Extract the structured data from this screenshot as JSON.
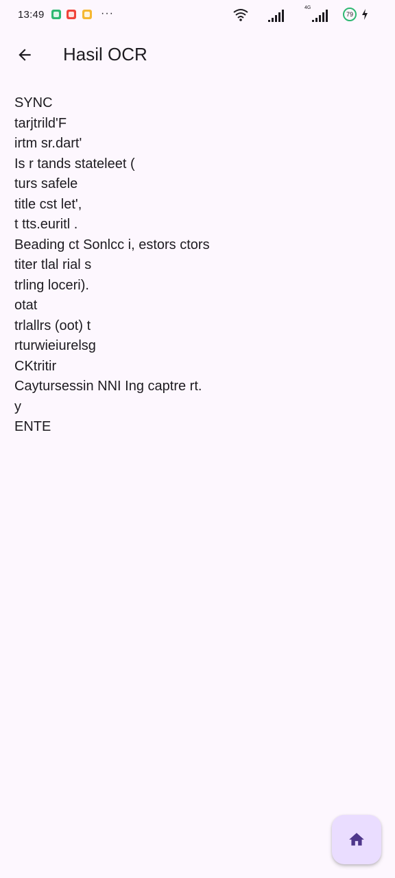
{
  "status_bar": {
    "time": "13:49",
    "more": "···",
    "network_type": "4G",
    "battery_level": "79"
  },
  "app_bar": {
    "title": "Hasil OCR",
    "back_icon": "arrow-back-icon"
  },
  "ocr_result": {
    "lines": [
      "SYNC",
      "tarjtrild'F",
      "irtm sr.dart'",
      "Is r tands stateleet (",
      "turs safele",
      "title cst let',",
      "t tts.euritl .",
      "Beading ct Sonlcc i, estors ctors",
      "titer tlal rial s",
      "trling loceri).",
      "otat",
      "trlallrs (oot) t",
      "rturwieiurelsg",
      "CKtritir",
      "Caytursessin NNI Ing captre rt.",
      "y",
      "ENTE"
    ]
  },
  "fab": {
    "icon": "home-icon"
  },
  "colors": {
    "background": "#FDF7FE",
    "fab_background": "#EADDFF",
    "fab_icon": "#4F378B",
    "text": "#1D1B20"
  }
}
